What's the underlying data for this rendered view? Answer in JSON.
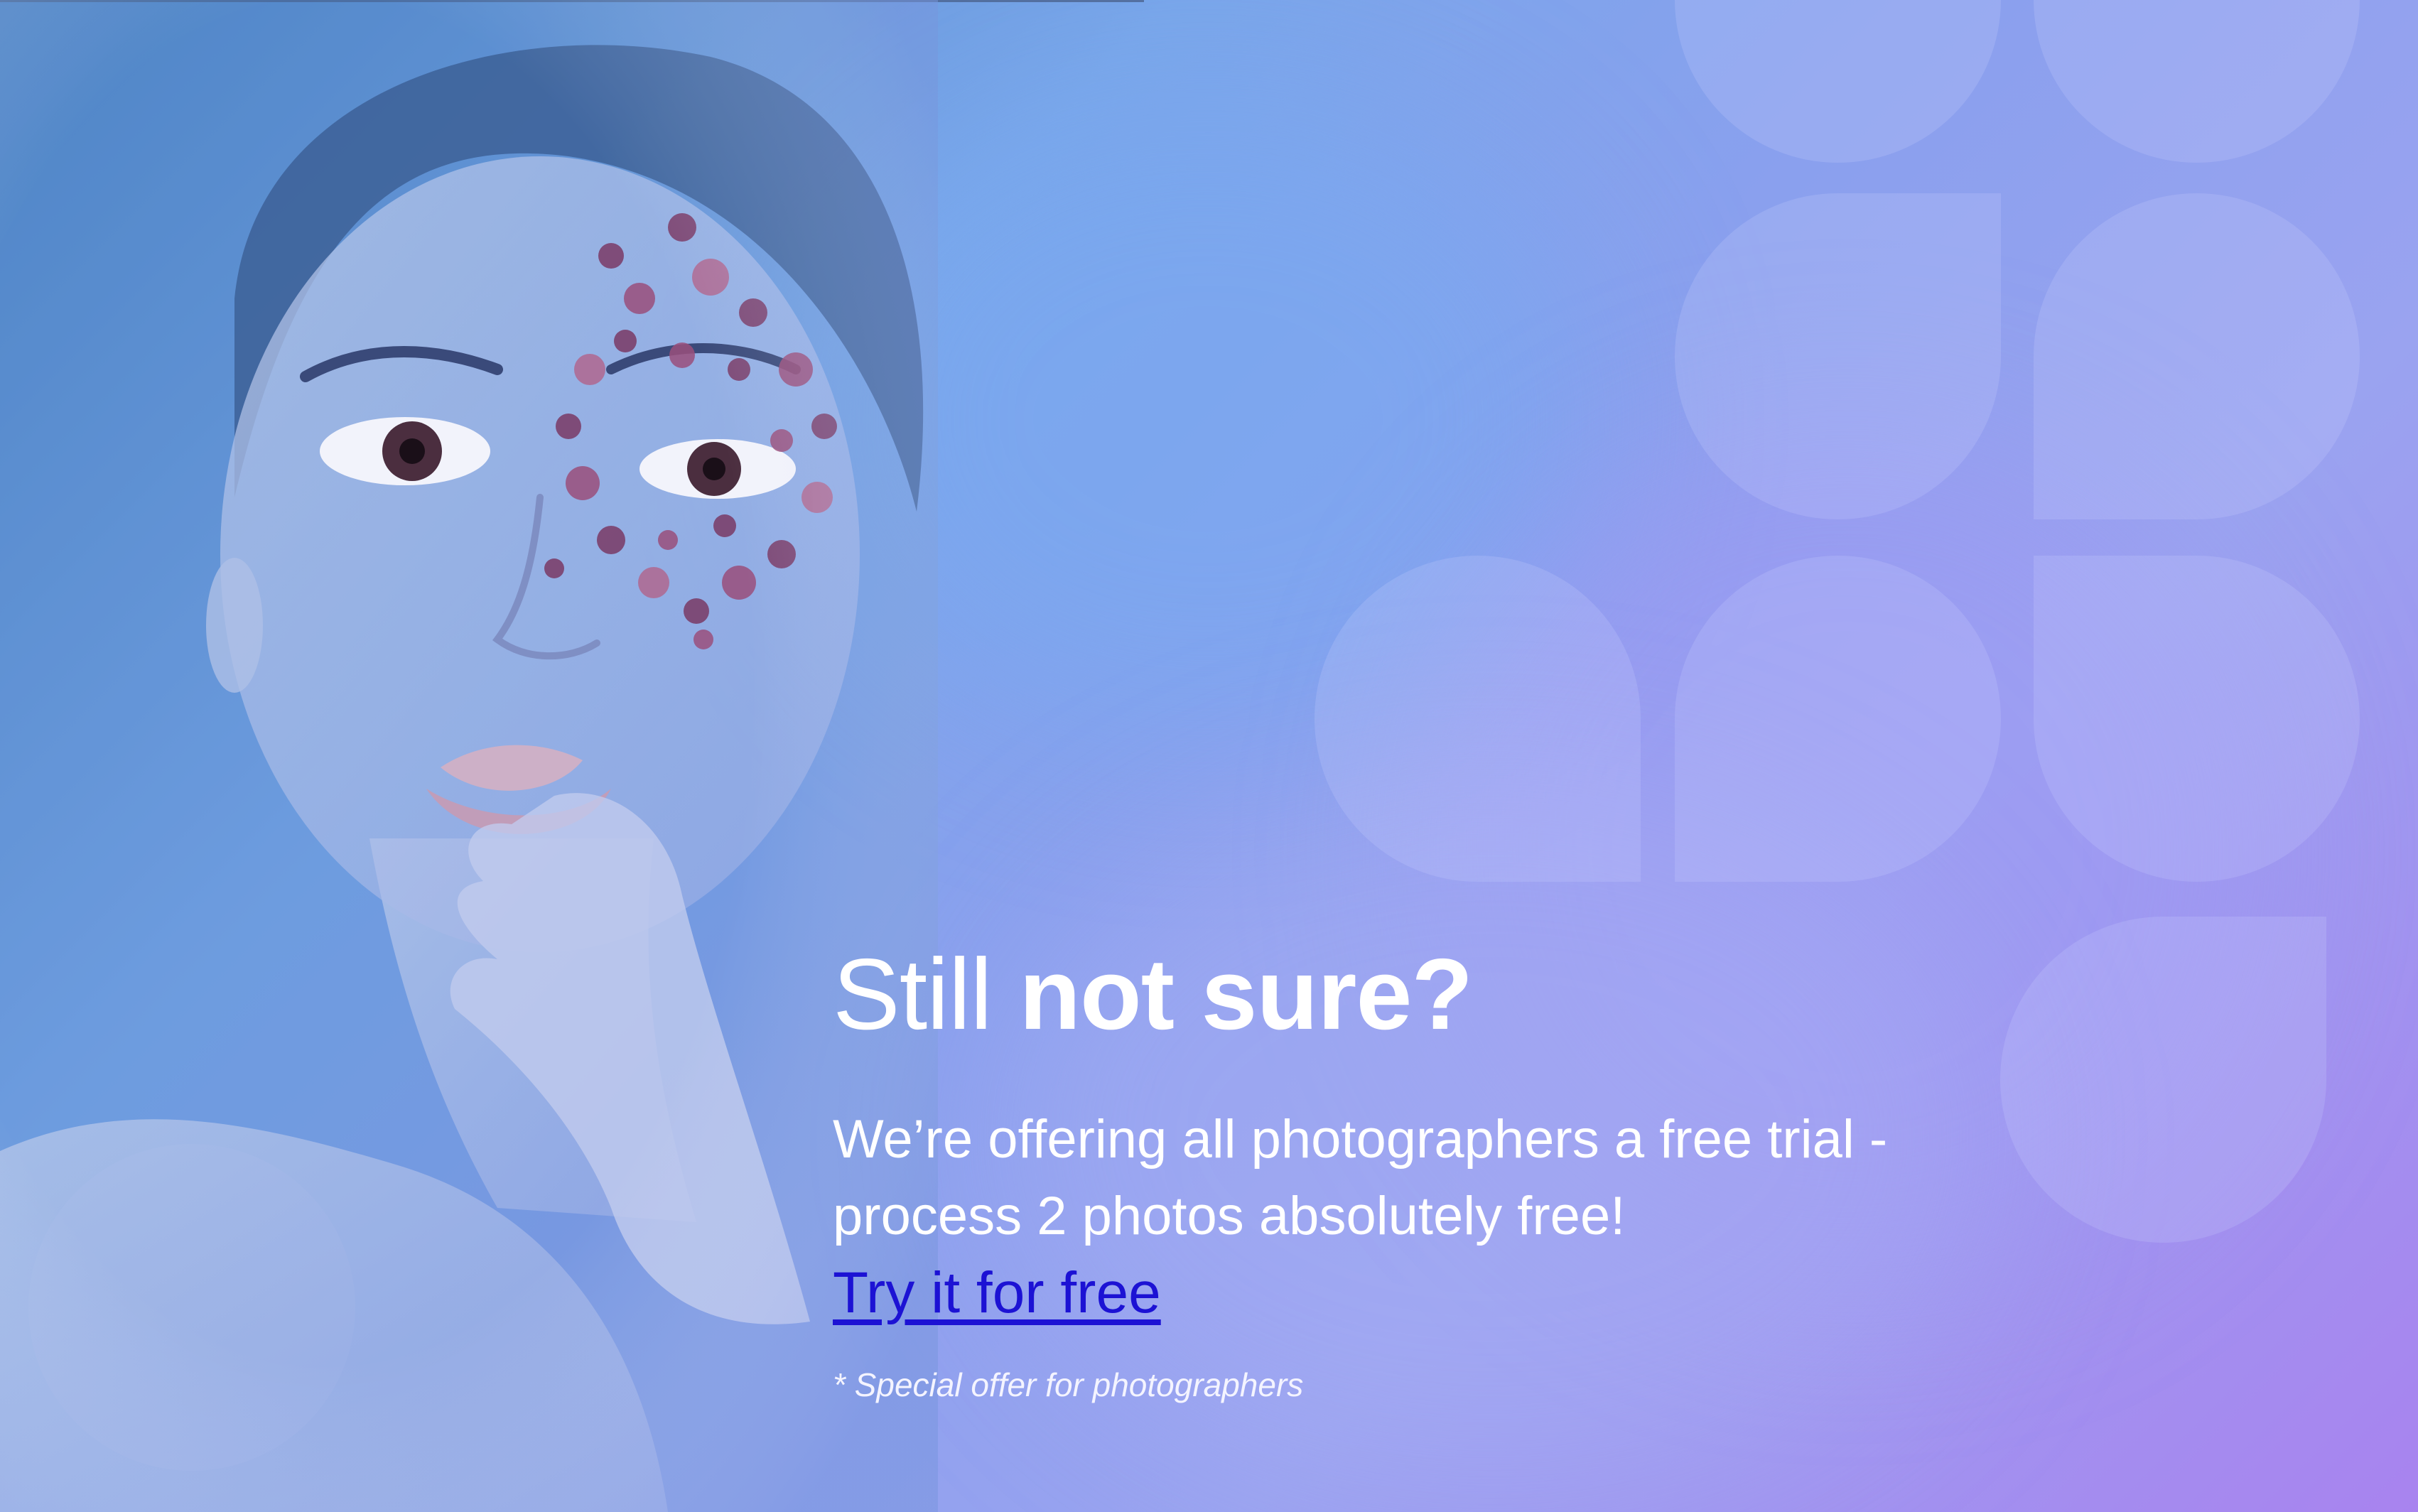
{
  "heading": {
    "light": "Still",
    "bold": "not sure?"
  },
  "lead_line1": "We’re offering all photographers a free trial -",
  "lead_line2": "process 2 photos absolutely free!",
  "cta_label": "Try it for free",
  "note": "* Special offer for photographers",
  "colors": {
    "link": "#1c12d4",
    "text": "#ffffff",
    "gradient_start": "#4f86c8",
    "gradient_end": "#a883ef"
  },
  "images": {
    "portrait": "portrait-photo-woman-with-jewel-face-art"
  }
}
